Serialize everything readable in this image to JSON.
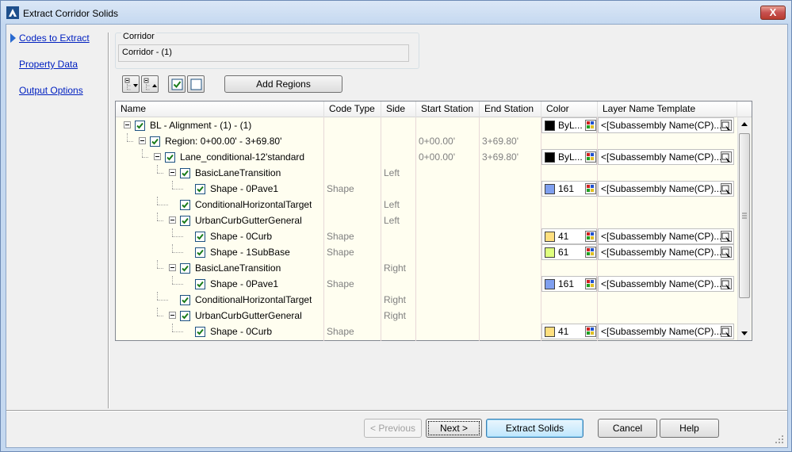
{
  "window": {
    "title": "Extract Corridor Solids",
    "close_label": "X"
  },
  "nav": {
    "items": [
      {
        "label": "Codes to Extract",
        "active": true
      },
      {
        "label": "Property Data",
        "active": false
      },
      {
        "label": "Output Options",
        "active": false
      }
    ]
  },
  "corridor": {
    "label": "Corridor",
    "value": "Corridor - (1)"
  },
  "toolbar": {
    "add_regions_label": "Add Regions"
  },
  "grid": {
    "columns": [
      "Name",
      "Code Type",
      "Side",
      "Start Station",
      "End Station",
      "Color",
      "Layer Name Template"
    ],
    "rows": [
      {
        "name": "BL - Alignment - (1) - (1)",
        "code_type": "",
        "side": "",
        "start": "",
        "end": "",
        "color_text": "ByL...",
        "swatch": "#000000",
        "layer": "<[Subassembly Name(CP)...",
        "level": 0,
        "toggle": true
      },
      {
        "name": "Region: 0+00.00' - 3+69.80'",
        "code_type": "",
        "side": "",
        "start": "0+00.00'",
        "end": "3+69.80'",
        "color_text": "",
        "swatch": "",
        "layer": "",
        "level": 1,
        "toggle": true
      },
      {
        "name": "Lane_conditional-12'standard",
        "code_type": "",
        "side": "",
        "start": "0+00.00'",
        "end": "3+69.80'",
        "color_text": "ByL...",
        "swatch": "#000000",
        "layer": "<[Subassembly Name(CP)...",
        "level": 2,
        "toggle": true
      },
      {
        "name": "BasicLaneTransition",
        "code_type": "",
        "side": "Left",
        "start": "",
        "end": "",
        "color_text": "",
        "swatch": "",
        "layer": "",
        "level": 3,
        "toggle": true
      },
      {
        "name": "Shape - 0Pave1",
        "code_type": "Shape",
        "side": "",
        "start": "",
        "end": "",
        "color_text": "161",
        "swatch": "#7f9fef",
        "layer": "<[Subassembly Name(CP)...",
        "level": 4,
        "toggle": false
      },
      {
        "name": "ConditionalHorizontalTarget",
        "code_type": "",
        "side": "Left",
        "start": "",
        "end": "",
        "color_text": "",
        "swatch": "",
        "layer": "",
        "level": 3,
        "toggle": false
      },
      {
        "name": "UrbanCurbGutterGeneral",
        "code_type": "",
        "side": "Left",
        "start": "",
        "end": "",
        "color_text": "",
        "swatch": "",
        "layer": "",
        "level": 3,
        "toggle": true
      },
      {
        "name": "Shape - 0Curb",
        "code_type": "Shape",
        "side": "",
        "start": "",
        "end": "",
        "color_text": "41",
        "swatch": "#ffdf7f",
        "layer": "<[Subassembly Name(CP)...",
        "level": 4,
        "toggle": false
      },
      {
        "name": "Shape - 1SubBase",
        "code_type": "Shape",
        "side": "",
        "start": "",
        "end": "",
        "color_text": "61",
        "swatch": "#dfff7f",
        "layer": "<[Subassembly Name(CP)...",
        "level": 4,
        "toggle": false
      },
      {
        "name": "BasicLaneTransition",
        "code_type": "",
        "side": "Right",
        "start": "",
        "end": "",
        "color_text": "",
        "swatch": "",
        "layer": "",
        "level": 3,
        "toggle": true
      },
      {
        "name": "Shape - 0Pave1",
        "code_type": "Shape",
        "side": "",
        "start": "",
        "end": "",
        "color_text": "161",
        "swatch": "#7f9fef",
        "layer": "<[Subassembly Name(CP)...",
        "level": 4,
        "toggle": false
      },
      {
        "name": "ConditionalHorizontalTarget",
        "code_type": "",
        "side": "Right",
        "start": "",
        "end": "",
        "color_text": "",
        "swatch": "",
        "layer": "",
        "level": 3,
        "toggle": false
      },
      {
        "name": "UrbanCurbGutterGeneral",
        "code_type": "",
        "side": "Right",
        "start": "",
        "end": "",
        "color_text": "",
        "swatch": "",
        "layer": "",
        "level": 3,
        "toggle": true
      },
      {
        "name": "Shape - 0Curb",
        "code_type": "Shape",
        "side": "",
        "start": "",
        "end": "",
        "color_text": "41",
        "swatch": "#ffdf7f",
        "layer": "<[Subassembly Name(CP)...",
        "level": 4,
        "toggle": false
      }
    ]
  },
  "buttons": {
    "previous": "< Previous",
    "next": "Next >",
    "extract": "Extract Solids",
    "cancel": "Cancel",
    "help": "Help"
  },
  "colors": {
    "link": "#0020c0",
    "grid_bg": "#fffef0",
    "checkbox_tick": "#1a7c1a"
  }
}
